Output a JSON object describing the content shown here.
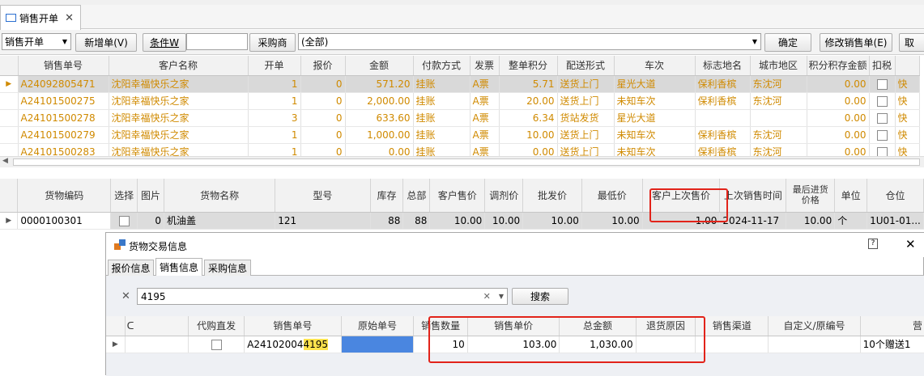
{
  "tab": {
    "title": "销售开单",
    "close": "✕"
  },
  "toolbar": {
    "doc_type": "销售开单",
    "new_order": "新增单(V)",
    "condition_label": "条件W",
    "condition_value": "",
    "buyer_button": "采购商",
    "buyer_value": "(全部)",
    "confirm": "确定",
    "modify": "修改销售单(E)",
    "cancel": "取"
  },
  "orders": {
    "columns": [
      "销售单号",
      "客户名称",
      "开单",
      "报价",
      "金额",
      "付款方式",
      "发票",
      "整单积分",
      "配送形式",
      "车次",
      "标志地名",
      "城市地区",
      "积分积存金额",
      "扣税",
      ""
    ],
    "rows": [
      [
        "A24092805471",
        "沈阳幸福快乐之家",
        "1",
        "0",
        "571.20",
        "挂账",
        "A票",
        "5.71",
        "送货上门",
        "星光大道",
        "保利香槟",
        "东沈河",
        "0.00",
        "",
        "快"
      ],
      [
        "A24101500275",
        "沈阳幸福快乐之家",
        "1",
        "0",
        "2,000.00",
        "挂账",
        "A票",
        "20.00",
        "送货上门",
        "未知车次",
        "保利香槟",
        "东沈河",
        "0.00",
        "",
        "快"
      ],
      [
        "A24101500278",
        "沈阳幸福快乐之家",
        "3",
        "0",
        "633.60",
        "挂账",
        "A票",
        "6.34",
        "货站发货",
        "星光大道",
        "",
        "",
        "0.00",
        "",
        "快"
      ],
      [
        "A24101500279",
        "沈阳幸福快乐之家",
        "1",
        "0",
        "1,000.00",
        "挂账",
        "A票",
        "10.00",
        "送货上门",
        "未知车次",
        "保利香槟",
        "东沈河",
        "0.00",
        "",
        "快"
      ],
      [
        "A24101500283",
        "沈阳幸福快乐之家",
        "1",
        "0",
        "0.00",
        "挂账",
        "A票",
        "0.00",
        "送货上门",
        "未知车次",
        "保利香槟",
        "东沈河",
        "0.00",
        "",
        "快"
      ]
    ]
  },
  "goods": {
    "columns": [
      "货物编码",
      "选择",
      "图片",
      "货物名称",
      "型号",
      "库存",
      "总部",
      "客户售价",
      "调剂价",
      "批发价",
      "最低价",
      "客户上次售价",
      "上次销售时间",
      "最后进货价格",
      "单位",
      "仓位"
    ],
    "row": [
      "0000100301",
      "",
      "0",
      "机油盖",
      "121",
      "88",
      "88",
      "10.00",
      "10.00",
      "10.00",
      "10.00",
      "1.00",
      "2024-11-17",
      "10.00",
      "个",
      "1U01-01..."
    ]
  },
  "popup": {
    "title": "货物交易信息",
    "help": "?",
    "close": "✕",
    "tabs": [
      "报价信息",
      "销售信息",
      "采购信息"
    ],
    "search_value": "4195",
    "search_button": "搜索",
    "columns": [
      "",
      "代购直发",
      "销售单号",
      "原始单号",
      "销售数量",
      "销售单价",
      "总金额",
      "退货原因",
      "销售渠道",
      "自定义/原编号",
      "营"
    ],
    "row": {
      "order_prefix": "A24102004",
      "order_highlight": "4195",
      "original": "",
      "qty": "10",
      "price": "103.00",
      "total": "1,030.00",
      "reason": "",
      "channel": "",
      "custom": "",
      "note": "10个赠送1"
    }
  },
  "colors": {
    "accent": "#2b6fd0",
    "row_text": "#d08a00",
    "highlight": "#ffe34d",
    "annotation": "#e2231a"
  }
}
